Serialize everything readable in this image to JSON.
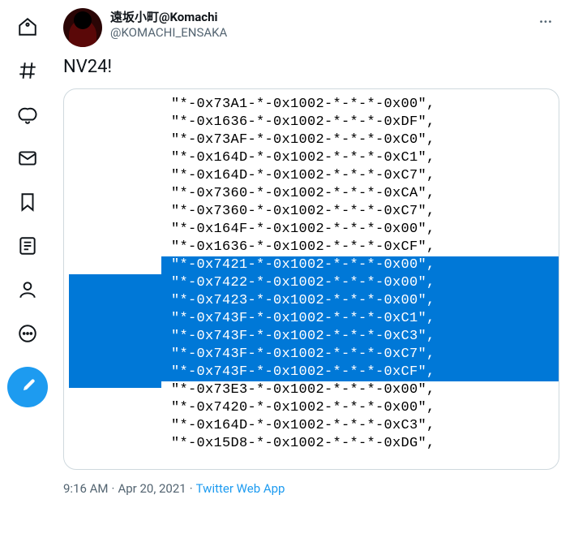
{
  "sidebar": {
    "items": [
      {
        "name": "home-icon"
      },
      {
        "name": "explore-icon"
      },
      {
        "name": "notifications-icon"
      },
      {
        "name": "messages-icon"
      },
      {
        "name": "bookmarks-icon"
      },
      {
        "name": "lists-icon"
      },
      {
        "name": "profile-icon"
      },
      {
        "name": "more-icon"
      }
    ],
    "compose": "Tweet"
  },
  "tweet": {
    "author": {
      "display_name": "遠坂小町@Komachi",
      "handle": "@KOMACHI_ENSAKA"
    },
    "text": "NV24!",
    "timestamp": "9:16 AM",
    "date": "Apr 20, 2021",
    "source": "Twitter Web App",
    "more_label": "···"
  },
  "media": {
    "code_lines": [
      {
        "text": "\"*-0x73A1-*-0x1002-*-*-*-0x00\",",
        "selected": false
      },
      {
        "text": "\"*-0x1636-*-0x1002-*-*-*-0xDF\",",
        "selected": false
      },
      {
        "text": "\"*-0x73AF-*-0x1002-*-*-*-0xC0\",",
        "selected": false
      },
      {
        "text": "\"*-0x164D-*-0x1002-*-*-*-0xC1\",",
        "selected": false
      },
      {
        "text": "\"*-0x164D-*-0x1002-*-*-*-0xC7\",",
        "selected": false
      },
      {
        "text": "\"*-0x7360-*-0x1002-*-*-*-0xCA\",",
        "selected": false
      },
      {
        "text": "\"*-0x7360-*-0x1002-*-*-*-0xC7\",",
        "selected": false
      },
      {
        "text": "\"*-0x164F-*-0x1002-*-*-*-0x00\",",
        "selected": false
      },
      {
        "text": "\"*-0x1636-*-0x1002-*-*-*-0xCF\",",
        "selected": false
      },
      {
        "text": "\"*-0x7421-*-0x1002-*-*-*-0x00\",",
        "selected": true
      },
      {
        "text": "\"*-0x7422-*-0x1002-*-*-*-0x00\",",
        "selected": true
      },
      {
        "text": "\"*-0x7423-*-0x1002-*-*-*-0x00\",",
        "selected": true
      },
      {
        "text": "\"*-0x743F-*-0x1002-*-*-*-0xC1\",",
        "selected": true
      },
      {
        "text": "\"*-0x743F-*-0x1002-*-*-*-0xC3\",",
        "selected": true
      },
      {
        "text": "\"*-0x743F-*-0x1002-*-*-*-0xC7\",",
        "selected": true
      },
      {
        "text": "\"*-0x743F-*-0x1002-*-*-*-0xCF\",",
        "selected": true
      },
      {
        "text": "\"*-0x73E3-*-0x1002-*-*-*-0x00\",",
        "selected": false
      },
      {
        "text": "\"*-0x7420-*-0x1002-*-*-*-0x00\",",
        "selected": false
      },
      {
        "text": "\"*-0x164D-*-0x1002-*-*-*-0xC3\",",
        "selected": false
      },
      {
        "text": "\"*-0x15D8-*-0x1002-*-*-*-0xDG\",",
        "selected": false
      }
    ]
  }
}
